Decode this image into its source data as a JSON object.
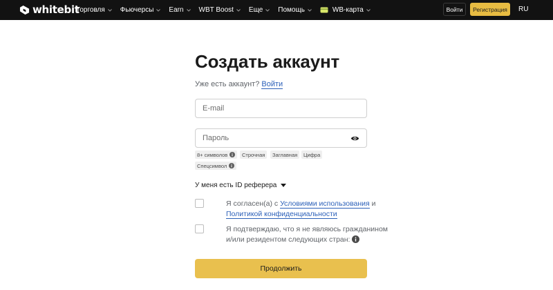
{
  "header": {
    "brand": "whitebit",
    "nav": [
      {
        "label": "Торговля",
        "has_dropdown": true
      },
      {
        "label": "Фьючерсы",
        "has_dropdown": true
      },
      {
        "label": "Earn",
        "has_dropdown": true
      },
      {
        "label": "WBT Boost",
        "has_dropdown": true
      },
      {
        "label": "Еще",
        "has_dropdown": true
      },
      {
        "label": "Помощь",
        "has_dropdown": true
      },
      {
        "label": "WB-карта",
        "has_dropdown": true,
        "icon": "card-icon"
      }
    ],
    "login_label": "Войти",
    "register_label": "Регистрация",
    "language": "RU"
  },
  "form": {
    "title": "Создать аккаунт",
    "have_account_text": "Уже есть аккаунт?",
    "have_account_link": "Войти",
    "email_placeholder": "E-mail",
    "password_placeholder": "Пароль",
    "password_rules": [
      "8+ символов",
      "Строчная",
      "Заглавная",
      "Цифра",
      "Спецсимвол"
    ],
    "referrer_label": "У меня есть ID реферера",
    "agree_prefix": "Я согласен(а) с",
    "terms_link": "Условиями использования",
    "agree_and": "и",
    "privacy_link": "Политикой конфиденциальности",
    "confirm_text": "Я подтверждаю, что я не являюсь гражданином и/или резидентом следующих стран:",
    "continue_label": "Продолжить"
  },
  "colors": {
    "header_bg": "#121212",
    "accent": "#e8bc42",
    "link": "#2a5fb8"
  }
}
